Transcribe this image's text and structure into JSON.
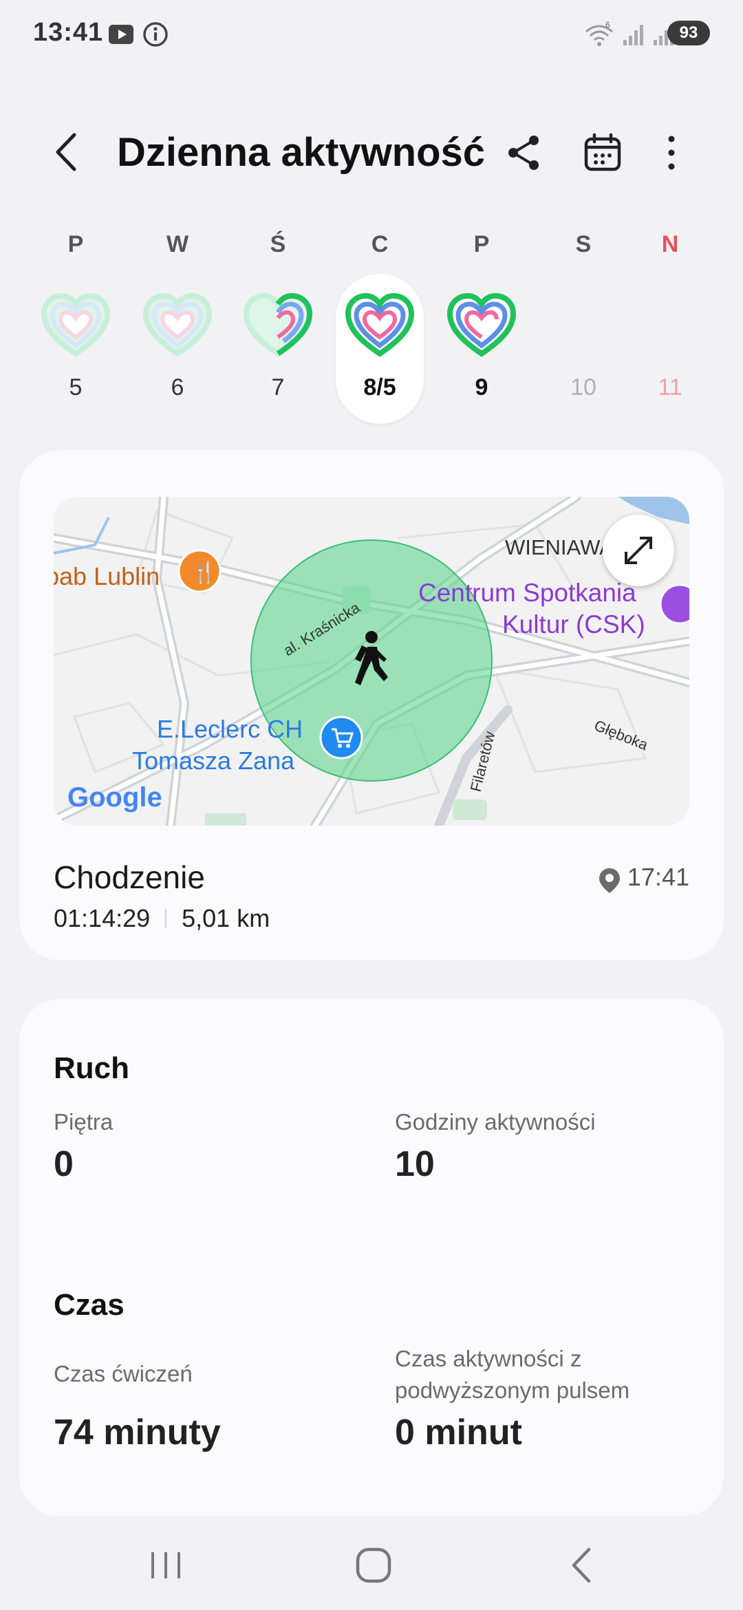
{
  "status": {
    "time": "13:41",
    "battery": "93",
    "icons": [
      "youtube-icon",
      "info-icon",
      "wifi-icon",
      "signal-icon",
      "signal-icon"
    ]
  },
  "header": {
    "title": "Dzienna aktywność",
    "icons": [
      "back-icon",
      "share-icon",
      "calendar-icon",
      "more-icon"
    ]
  },
  "week": {
    "days": [
      {
        "letter": "P",
        "num": "5"
      },
      {
        "letter": "W",
        "num": "6"
      },
      {
        "letter": "Ś",
        "num": "7"
      },
      {
        "letter": "C",
        "num": "8/5"
      },
      {
        "letter": "P",
        "num": "9"
      },
      {
        "letter": "S",
        "num": "10"
      },
      {
        "letter": "N",
        "num": "11"
      }
    ]
  },
  "map": {
    "labels": {
      "district": "WIENIAWA",
      "poi_restaurant": "bab Lublin",
      "poi_csk_line1": "Centrum Spotkania",
      "poi_csk_line2": "Kultur (CSK)",
      "poi_shop_line1": "E.Leclerc CH",
      "poi_shop_line2": "Tomasza Zana",
      "street1": "al. Kraśnicka",
      "street2": "Głęboka",
      "street3": "Filaretów",
      "brand": "Google"
    }
  },
  "activity": {
    "name": "Chodzenie",
    "start_time": "17:41",
    "duration": "01:14:29",
    "distance": "5,01 km"
  },
  "summary": {
    "movement_title": "Ruch",
    "floors_label": "Piętra",
    "floors_value": "0",
    "active_hours_label": "Godziny aktywności",
    "active_hours_value": "10",
    "time_title": "Czas",
    "exercise_label": "Czas ćwiczeń",
    "exercise_value": "74 minuty",
    "elevated_label_line1": "Czas aktywności z",
    "elevated_label_line2": "podwyższonym pulsem",
    "elevated_value": "0 minut"
  },
  "colors": {
    "accent_green": "#21c15b",
    "sunday_red": "#e8505b",
    "map_circle": "#5fd690"
  }
}
